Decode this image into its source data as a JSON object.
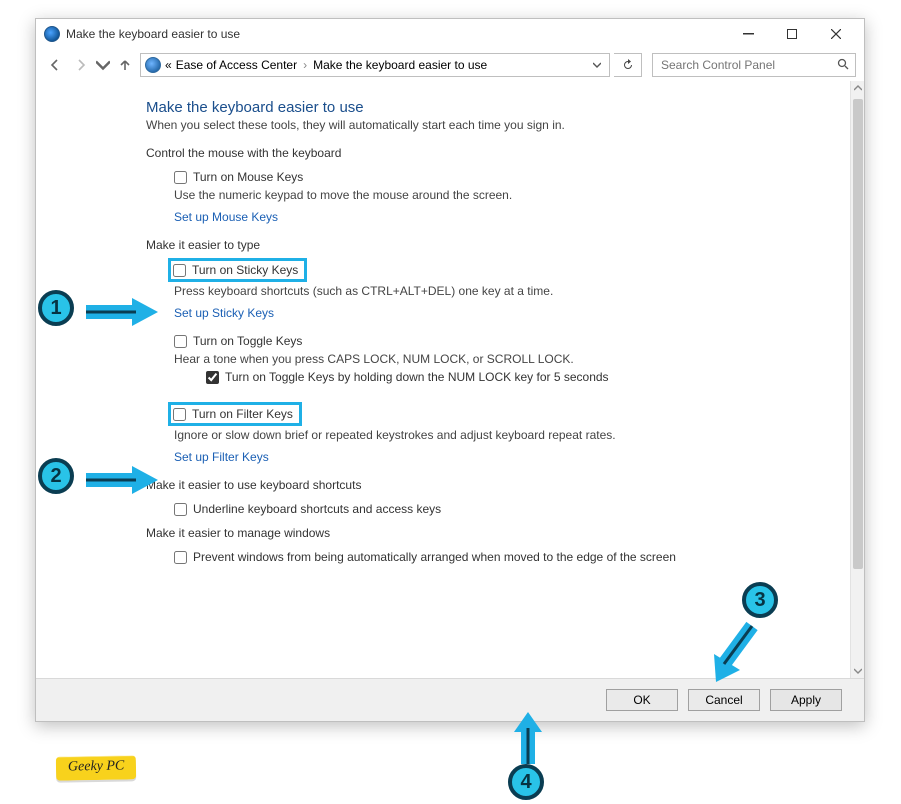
{
  "window": {
    "title": "Make the keyboard easier to use"
  },
  "addressbar": {
    "prefix": "«",
    "path1": "Ease of Access Center",
    "path2": "Make the keyboard easier to use"
  },
  "search": {
    "placeholder": "Search Control Panel"
  },
  "page": {
    "heading": "Make the keyboard easier to use",
    "sub": "When you select these tools, they will automatically start each time you sign in."
  },
  "mouse_group": {
    "legend": "Control the mouse with the keyboard",
    "chk": "Turn on Mouse Keys",
    "desc": "Use the numeric keypad to move the mouse around the screen.",
    "link": "Set up Mouse Keys"
  },
  "type_group": {
    "legend": "Make it easier to type",
    "sticky_chk": "Turn on Sticky Keys",
    "sticky_desc": "Press keyboard shortcuts (such as CTRL+ALT+DEL) one key at a time.",
    "sticky_link": "Set up Sticky Keys",
    "toggle_chk": "Turn on Toggle Keys",
    "toggle_desc": "Hear a tone when you press CAPS LOCK, NUM LOCK, or SCROLL LOCK.",
    "toggle_hold": "Turn on Toggle Keys by holding down the NUM LOCK key for 5 seconds",
    "filter_chk": "Turn on Filter Keys",
    "filter_desc": "Ignore or slow down brief or repeated keystrokes and adjust keyboard repeat rates.",
    "filter_link": "Set up Filter Keys"
  },
  "shortcuts_group": {
    "legend": "Make it easier to use keyboard shortcuts",
    "chk": "Underline keyboard shortcuts and access keys"
  },
  "windows_group": {
    "legend": "Make it easier to manage windows",
    "chk": "Prevent windows from being automatically arranged when moved to the edge of the screen"
  },
  "buttons": {
    "ok": "OK",
    "cancel": "Cancel",
    "apply": "Apply"
  },
  "annotations": {
    "b1": "1",
    "b2": "2",
    "b3": "3",
    "b4": "4"
  },
  "watermark": "Geeky PC"
}
